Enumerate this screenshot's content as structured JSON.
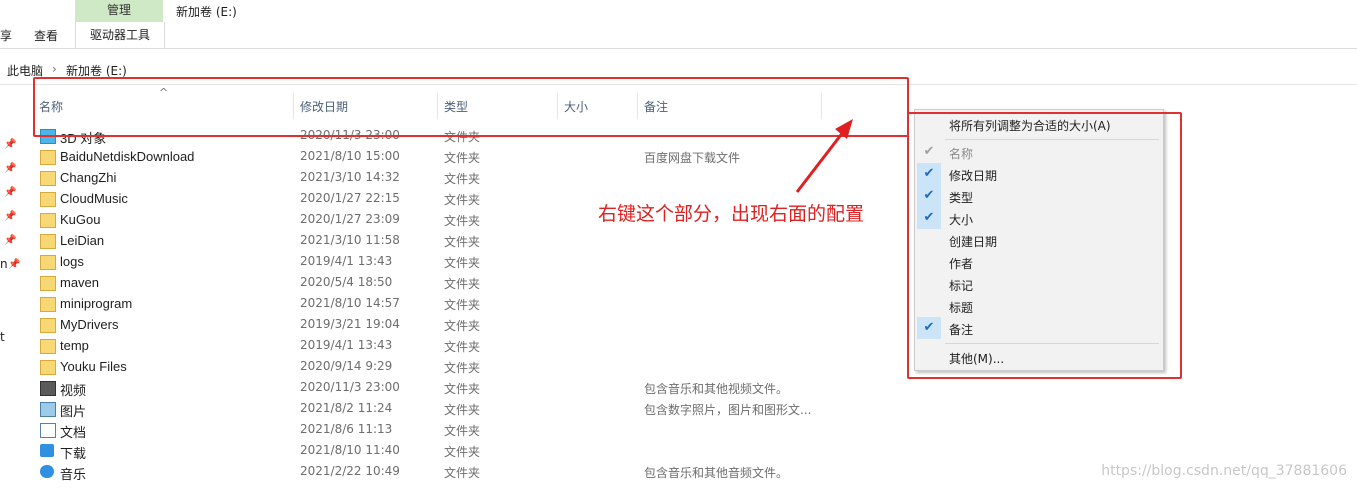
{
  "ribbon": {
    "manage_tab": "管理",
    "title": "新加卷 (E:)",
    "partial_tab": "享",
    "view_tab": "查看",
    "drive_tools_tab": "驱动器工具"
  },
  "address": {
    "crumb1": "此电脑",
    "sep": "›",
    "crumb2": "新加卷 (E:)"
  },
  "columns": [
    "名称",
    "修改日期",
    "类型",
    "大小",
    "备注"
  ],
  "sort_indicator": "^",
  "files": [
    {
      "name": "3D 对象",
      "date": "2020/11/3 23:00",
      "type": "文件夹",
      "note": "",
      "icon": "3d-objects-icon"
    },
    {
      "name": "BaiduNetdiskDownload",
      "date": "2021/8/10 15:00",
      "type": "文件夹",
      "note": "百度网盘下载文件",
      "icon": "folder-icon"
    },
    {
      "name": "ChangZhi",
      "date": "2021/3/10 14:32",
      "type": "文件夹",
      "note": "",
      "icon": "folder-icon"
    },
    {
      "name": "CloudMusic",
      "date": "2020/1/27 22:15",
      "type": "文件夹",
      "note": "",
      "icon": "folder-icon"
    },
    {
      "name": "KuGou",
      "date": "2020/1/27 23:09",
      "type": "文件夹",
      "note": "",
      "icon": "folder-icon"
    },
    {
      "name": "LeiDian",
      "date": "2021/3/10 11:58",
      "type": "文件夹",
      "note": "",
      "icon": "folder-icon"
    },
    {
      "name": "logs",
      "date": "2019/4/1 13:43",
      "type": "文件夹",
      "note": "",
      "icon": "folder-icon"
    },
    {
      "name": "maven",
      "date": "2020/5/4 18:50",
      "type": "文件夹",
      "note": "",
      "icon": "folder-icon"
    },
    {
      "name": "miniprogram",
      "date": "2021/8/10 14:57",
      "type": "文件夹",
      "note": "",
      "icon": "folder-icon"
    },
    {
      "name": "MyDrivers",
      "date": "2019/3/21 19:04",
      "type": "文件夹",
      "note": "",
      "icon": "folder-icon"
    },
    {
      "name": "temp",
      "date": "2019/4/1 13:43",
      "type": "文件夹",
      "note": "",
      "icon": "folder-icon"
    },
    {
      "name": "Youku Files",
      "date": "2020/9/14 9:29",
      "type": "文件夹",
      "note": "",
      "icon": "folder-icon"
    },
    {
      "name": "视频",
      "date": "2020/11/3 23:00",
      "type": "文件夹",
      "note": "包含音乐和其他视频文件。",
      "icon": "video-icon"
    },
    {
      "name": "图片",
      "date": "2021/8/2 11:24",
      "type": "文件夹",
      "note": "包含数字照片，图片和图形文...",
      "icon": "pictures-icon"
    },
    {
      "name": "文档",
      "date": "2021/8/6 11:13",
      "type": "文件夹",
      "note": "",
      "icon": "documents-icon"
    },
    {
      "name": "下载",
      "date": "2021/8/10 11:40",
      "type": "文件夹",
      "note": "",
      "icon": "download-icon"
    },
    {
      "name": "音乐",
      "date": "2021/2/22 10:49",
      "type": "文件夹",
      "note": "包含音乐和其他音频文件。",
      "icon": "music-icon"
    }
  ],
  "left_pane": {
    "pin_glyph": "📌",
    "partial_n": "n",
    "partial_t": "t"
  },
  "context_menu": {
    "fit_all": "将所有列调整为合适的大小(A)",
    "items": [
      {
        "label": "名称",
        "checked": true,
        "disabled": true
      },
      {
        "label": "修改日期",
        "checked": true,
        "disabled": false
      },
      {
        "label": "类型",
        "checked": true,
        "disabled": false
      },
      {
        "label": "大小",
        "checked": true,
        "disabled": false
      },
      {
        "label": "创建日期",
        "checked": false,
        "disabled": false
      },
      {
        "label": "作者",
        "checked": false,
        "disabled": false
      },
      {
        "label": "标记",
        "checked": false,
        "disabled": false
      },
      {
        "label": "标题",
        "checked": false,
        "disabled": false
      },
      {
        "label": "备注",
        "checked": true,
        "disabled": false
      }
    ],
    "more": "其他(M)...",
    "check_glyph": "✔"
  },
  "annotation": "右键这个部分，出现右面的配置",
  "watermark": "https://blog.csdn.net/qq_37881606",
  "colors": {
    "highlight": "#e03030",
    "manage_tab": "#cfe8c5",
    "check_bg": "#cce4f7"
  }
}
